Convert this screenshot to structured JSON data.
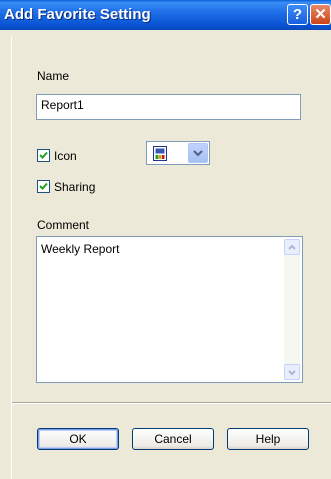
{
  "window": {
    "title": "Add Favorite Setting",
    "help_button": "?",
    "close_button": "✕"
  },
  "name": {
    "label": "Name",
    "value": "Report1"
  },
  "icon": {
    "label": "Icon",
    "checked": true
  },
  "sharing": {
    "label": "Sharing",
    "checked": true
  },
  "comment": {
    "label": "Comment",
    "value": "Weekly Report"
  },
  "buttons": {
    "ok": "OK",
    "cancel": "Cancel",
    "help": "Help"
  }
}
